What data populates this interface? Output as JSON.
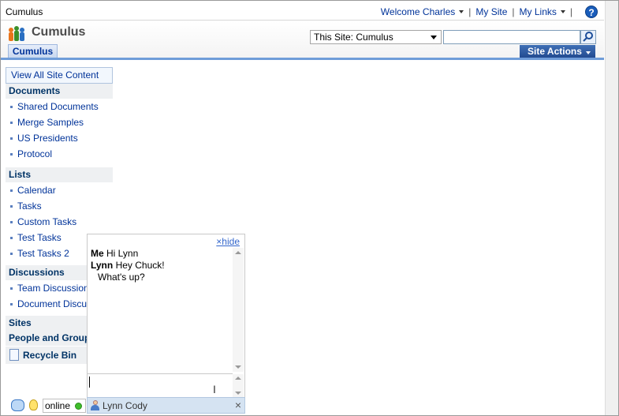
{
  "topbar": {
    "site": "Cumulus",
    "welcome": "Welcome Charles",
    "my_site": "My Site",
    "my_links": "My Links",
    "sep": "|",
    "help": "?"
  },
  "header": {
    "title": "Cumulus",
    "scope": "This Site: Cumulus",
    "search_placeholder": "",
    "tab": "Cumulus",
    "site_actions": "Site Actions"
  },
  "quicklaunch": {
    "view_all": "View All Site Content",
    "documents": {
      "heading": "Documents",
      "items": [
        "Shared Documents",
        "Merge Samples",
        "US Presidents",
        "Protocol"
      ]
    },
    "lists": {
      "heading": "Lists",
      "items": [
        "Calendar",
        "Tasks",
        "Custom Tasks",
        "Test Tasks",
        "Test Tasks 2"
      ]
    },
    "discussions": {
      "heading": "Discussions",
      "items": [
        "Team Discussion",
        "Document Discussi"
      ]
    },
    "sites": "Sites",
    "people": "People and Group",
    "recycle": "Recycle Bin"
  },
  "chat": {
    "hide": "×hide",
    "messages": [
      {
        "who": "Me",
        "text": "Hi Lynn"
      },
      {
        "who": "Lynn",
        "text": "Hey Chuck!"
      }
    ],
    "continuation": "What's up?",
    "input_value": ""
  },
  "statusbar": {
    "status": "online",
    "contact": "Lynn Cody",
    "close": "×"
  },
  "colors": {
    "link": "#003399",
    "site_actions_bg": "#21498f",
    "online": "#3fbd2a"
  }
}
